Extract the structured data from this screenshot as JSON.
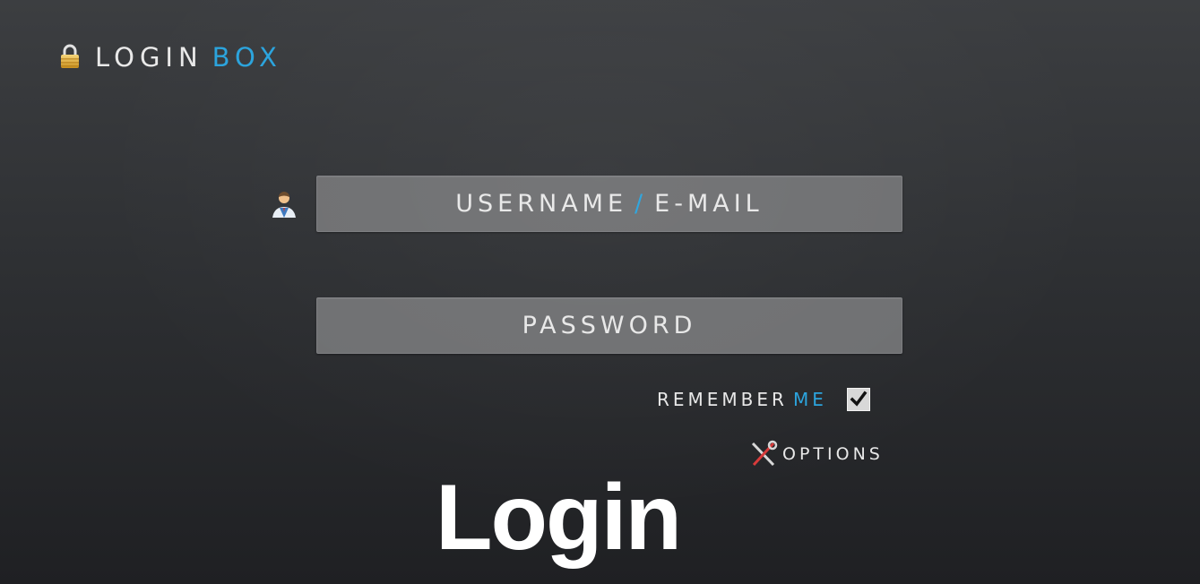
{
  "header": {
    "title_main": "LOGIN",
    "title_accent": "BOX",
    "icon": "lock-icon"
  },
  "form": {
    "username": {
      "placeholder_main": "USERNAME",
      "placeholder_separator": "/",
      "placeholder_accent_after": "E-MAIL",
      "icon": "user-icon"
    },
    "password": {
      "placeholder": "PASSWORD"
    },
    "remember": {
      "label_main": "REMEMBER",
      "label_accent": "ME",
      "checked": true
    },
    "options": {
      "label": "OPTIONS",
      "icon": "tools-icon"
    }
  },
  "caption": "Login",
  "colors": {
    "accent": "#2aa3dd",
    "field_bg": "#6f7072",
    "text": "#e8e8e8",
    "background_top": "#3c3e41",
    "background_bottom": "#1f2023"
  }
}
